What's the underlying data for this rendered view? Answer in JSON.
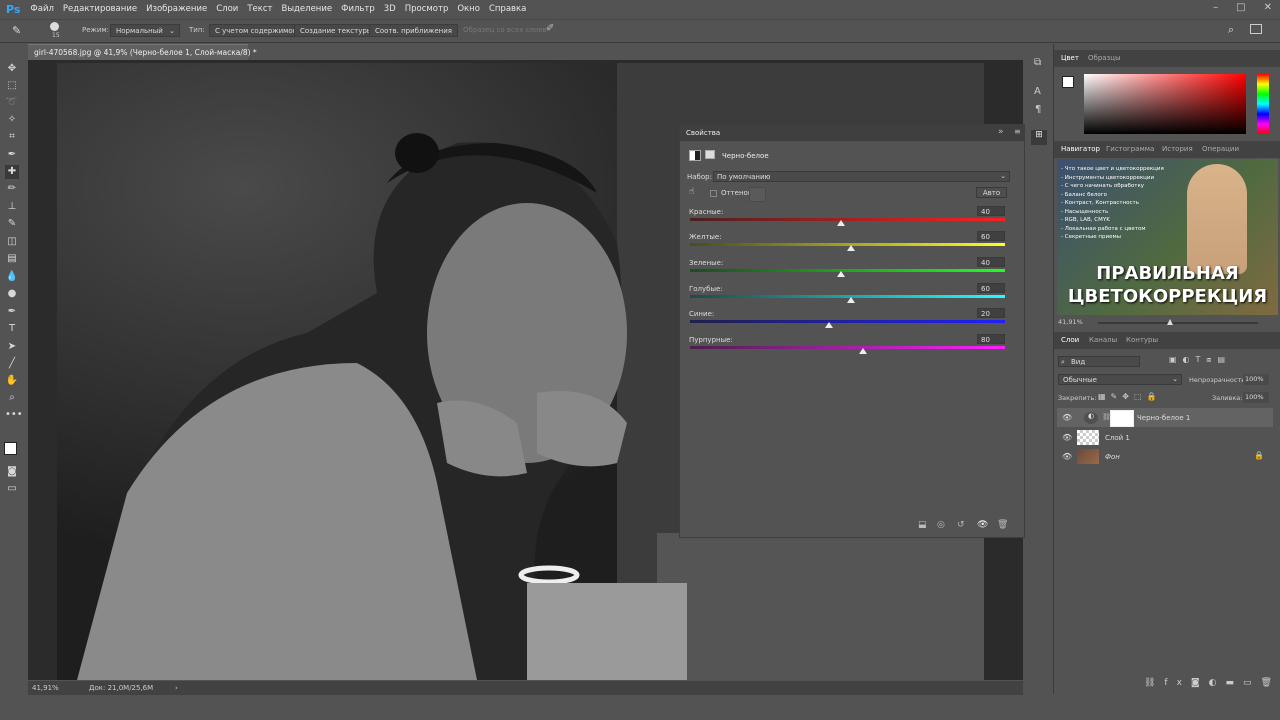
{
  "app": {
    "logo": "Ps"
  },
  "menu": [
    "Файл",
    "Редактирование",
    "Изображение",
    "Слои",
    "Текст",
    "Выделение",
    "Фильтр",
    "3D",
    "Просмотр",
    "Окно",
    "Справка"
  ],
  "window_controls": [
    "–",
    "□",
    "✕"
  ],
  "options_bar": {
    "brush_size": "15",
    "mode_label": "Режим:",
    "mode_value": "Нормальный",
    "type_label": "Тип:",
    "type_buttons": [
      "С учетом содержимого",
      "Создание текстуры",
      "Соотв. приближения"
    ],
    "sample_all": "Образец со всех слоев"
  },
  "document": {
    "tab_title": "girl-470568.jpg @ 41,9% (Черно-белое 1, Слой-маска/8) *",
    "zoom": "41,91%",
    "doc_size": "Док: 21,0M/25,6M"
  },
  "properties": {
    "title": "Свойства",
    "adjustment_name": "Черно-белое",
    "preset_label": "Набор:",
    "preset_value": "По умолчанию",
    "tint_label": "Оттенок",
    "auto_button": "Авто",
    "sliders": [
      {
        "label": "Красные:",
        "value": "40",
        "level": 0.48,
        "color_from": "#4a2020",
        "color_to": "#ff2020"
      },
      {
        "label": "Желтые:",
        "value": "60",
        "level": 0.51,
        "color_from": "#4a4a20",
        "color_to": "#ffff20"
      },
      {
        "label": "Зеленые:",
        "value": "40",
        "level": 0.48,
        "color_from": "#204a20",
        "color_to": "#20ff20"
      },
      {
        "label": "Голубые:",
        "value": "60",
        "level": 0.51,
        "color_from": "#204a4a",
        "color_to": "#20ffff"
      },
      {
        "label": "Синие:",
        "value": "20",
        "level": 0.44,
        "color_from": "#20204a",
        "color_to": "#2020ff"
      },
      {
        "label": "Пурпурные:",
        "value": "80",
        "level": 0.55,
        "color_from": "#4a204a",
        "color_to": "#ff20ff"
      }
    ]
  },
  "color_panel": {
    "tabs": [
      "Цвет",
      "Образцы"
    ]
  },
  "navigator_panel": {
    "tabs": [
      "Навигатор",
      "Гистограмма",
      "История",
      "Операции"
    ],
    "zoom": "41,91%",
    "promo_list": [
      "- Что такое цвет и цветокоррекция",
      "- Инструменты цветокоррекции",
      "- С чего начинать обработку",
      "- Баланс белого",
      "- Контраст, Контрастность",
      "- Насыщенность",
      "- RGB, LAB, CMYK",
      "- Локальная работа с цветом",
      "- Секретные приемы"
    ],
    "promo_title_1": "ПРАВИЛЬНАЯ",
    "promo_title_2": "ЦВЕТОКОРРЕКЦИЯ"
  },
  "layers_panel": {
    "tabs": [
      "Слои",
      "Каналы",
      "Контуры"
    ],
    "filter": "Вид",
    "blend_mode": "Обычные",
    "opacity_label": "Непрозрачность:",
    "opacity_value": "100%",
    "lock_label": "Закрепить:",
    "fill_label": "Заливка:",
    "fill_value": "100%",
    "layers": [
      "Черно-белое 1",
      "Слой 1",
      "Фон"
    ]
  }
}
